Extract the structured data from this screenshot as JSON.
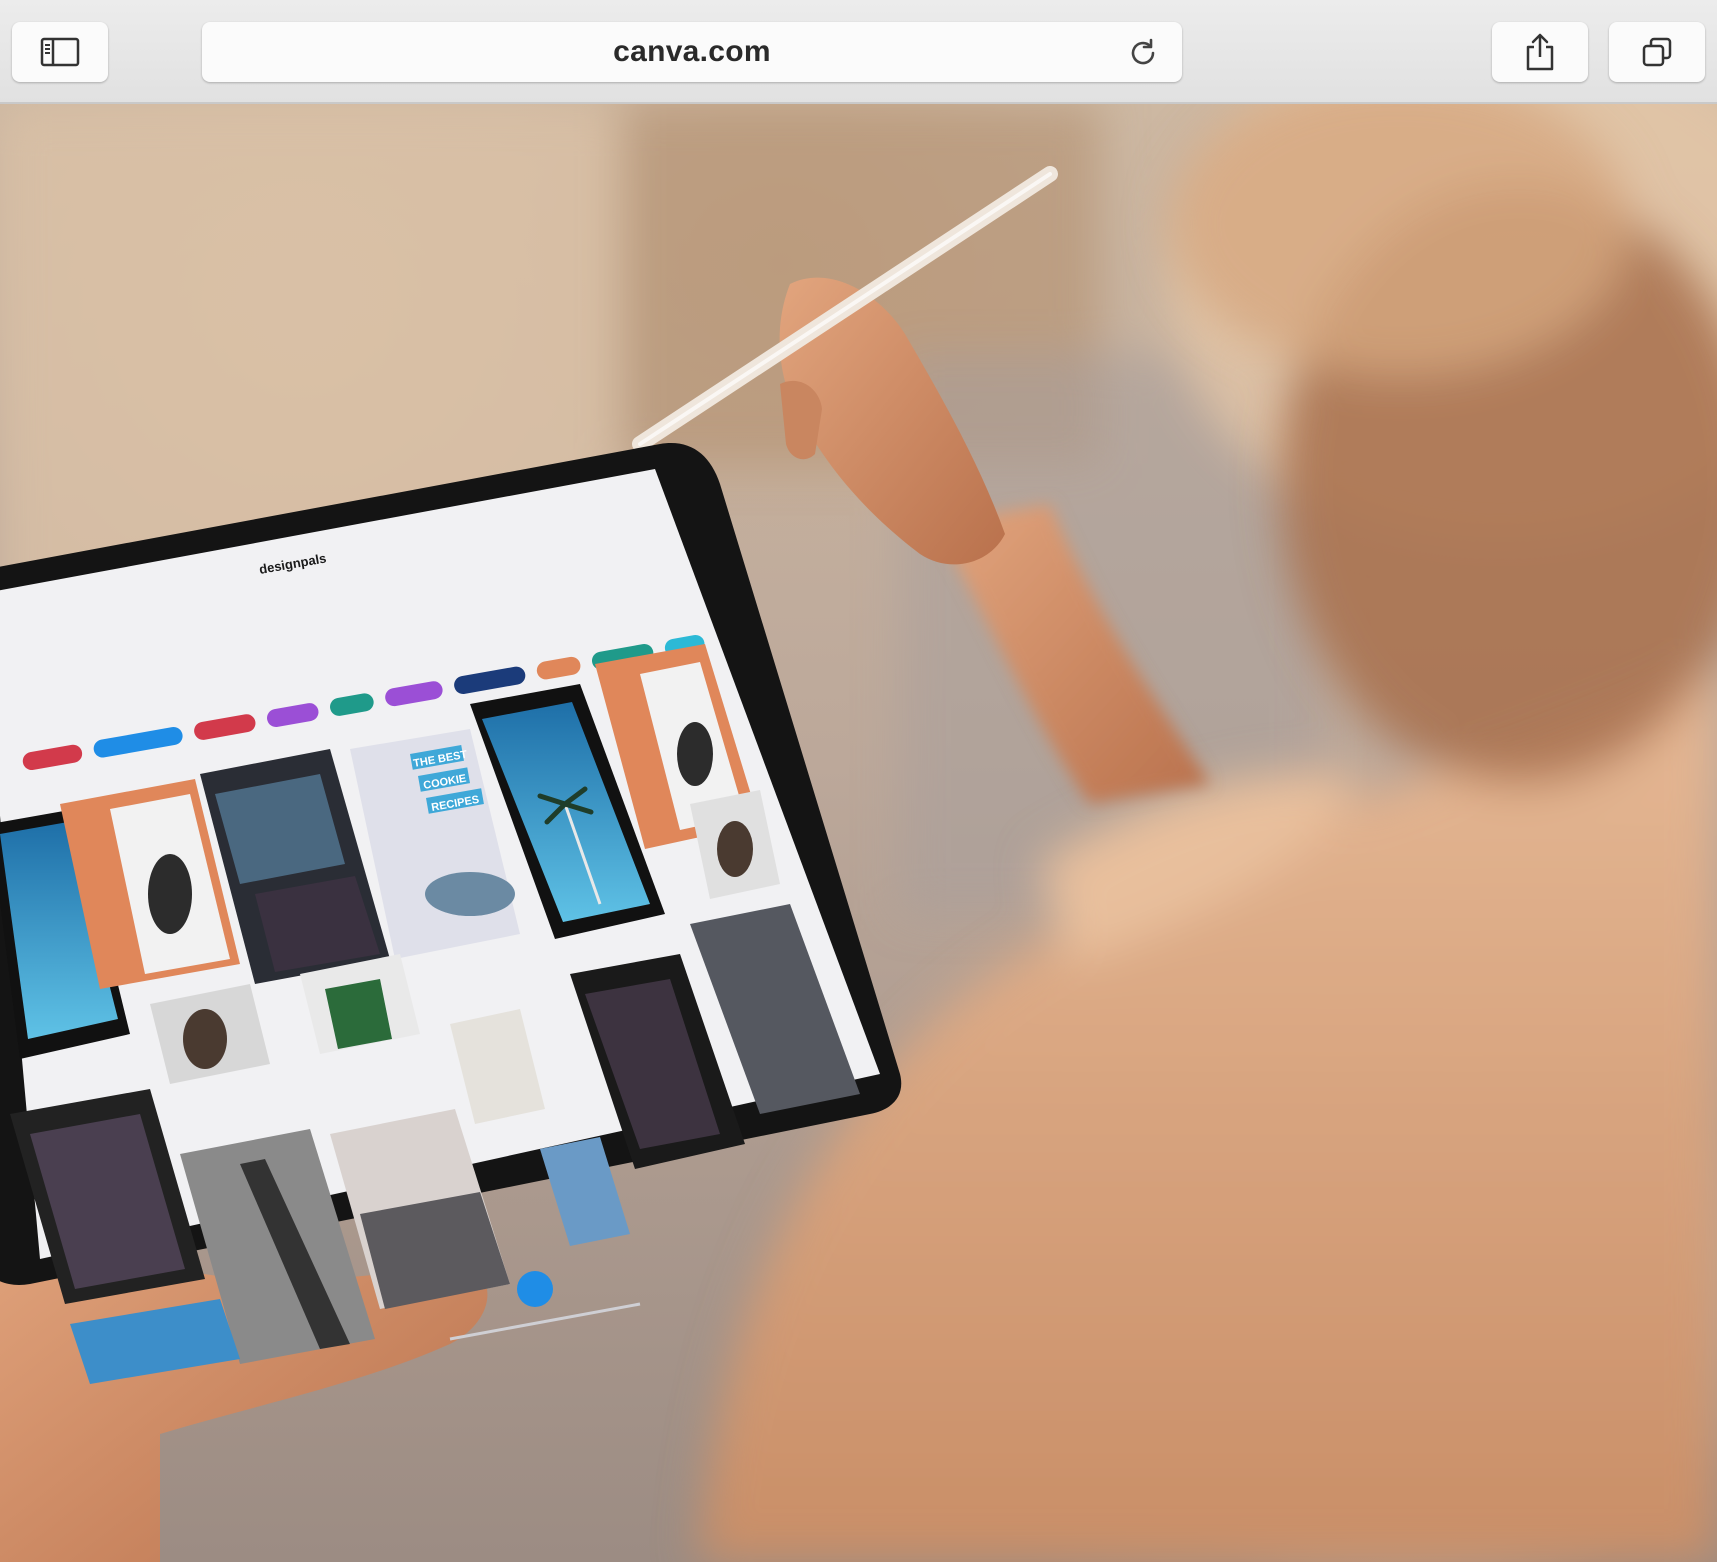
{
  "browser": {
    "url": "canva.com",
    "icons": {
      "sidebar": "sidebar-icon",
      "reload": "reload-icon",
      "share": "share-icon",
      "tabs": "tabs-icon"
    }
  },
  "photo": {
    "tablet_screen": {
      "brand": "designpals",
      "tile_text": [
        "THE BEST",
        "COOKIE",
        "RECIPES"
      ]
    }
  },
  "colors": {
    "toolbar": "#e6e6e6",
    "accent_blue": "#1f8de6",
    "pill_red": "#d23a4b",
    "pill_purple": "#9b4fd6",
    "pill_teal": "#1f9a8a",
    "pill_navy": "#1b3b7a",
    "tile_orange": "#e0875a"
  }
}
